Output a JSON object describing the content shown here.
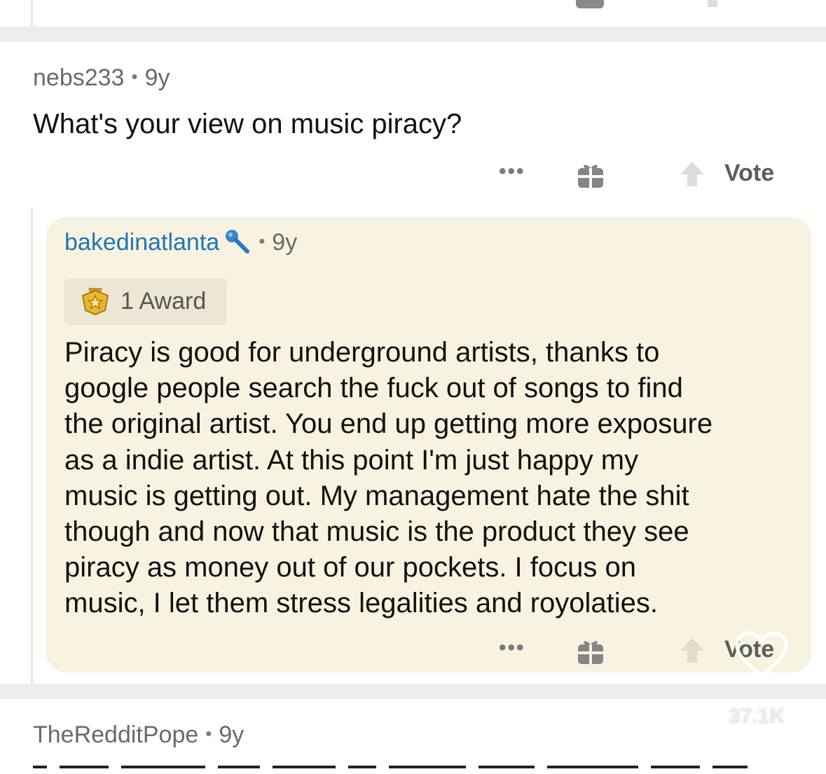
{
  "comment_top": {
    "username": "nebs233",
    "age": "9y",
    "body": "What's your view on music piracy?",
    "actions": {
      "more_label": "•••",
      "vote_label": "Vote"
    }
  },
  "reply": {
    "username": "bakedinatlanta",
    "age": "9y",
    "flair_icon": "microphone-icon",
    "award": {
      "icon": "star-award-icon",
      "label": "1 Award"
    },
    "body_lines": [
      "Piracy is good for underground artists, thanks to",
      "google people search the fuck out of songs to find",
      "the original artist.  You end up getting more exposure",
      "as a indie artist.  At this point I'm just happy my",
      "music is getting out.  My management hate the shit",
      "though and now that music is the product they see",
      "piracy as money out of our pockets.  I focus on",
      "music, I let them stress legalities and royolaties."
    ],
    "actions": {
      "more_label": "•••",
      "vote_label": "Vote"
    }
  },
  "comment_bottom": {
    "username": "TheRedditPope",
    "age": "9y"
  },
  "overlay": {
    "like_icon": "heart-outline-icon",
    "like_count": "37.1K"
  },
  "colors": {
    "reply_background": "#f8f3e1",
    "username_link": "#1f76b6",
    "divider": "#ededed"
  }
}
